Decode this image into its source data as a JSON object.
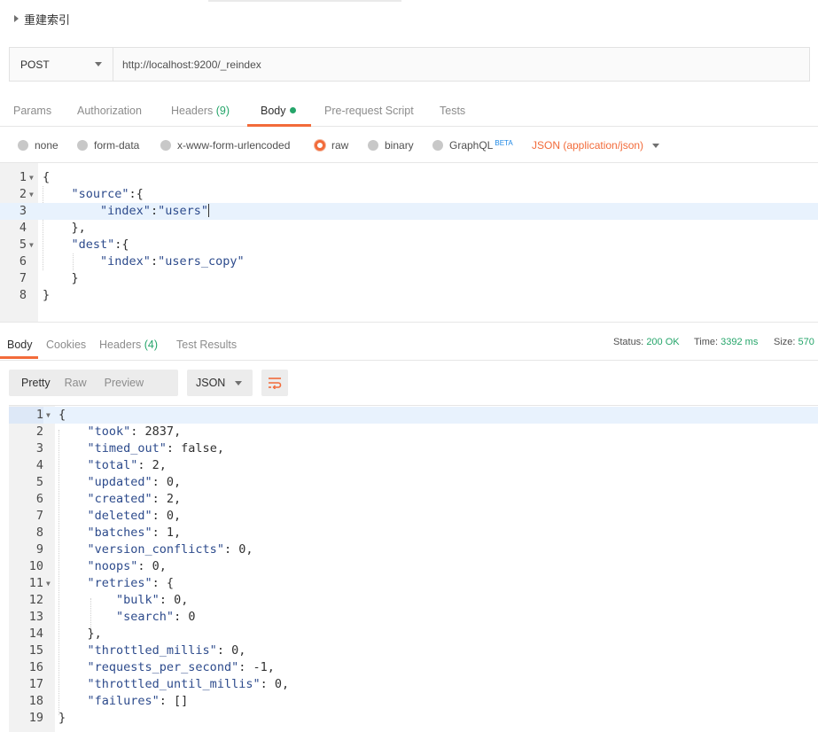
{
  "request": {
    "title": "重建索引",
    "method": "POST",
    "url": "http://localhost:9200/_reindex"
  },
  "request_tabs": [
    {
      "label": "Params"
    },
    {
      "label": "Authorization"
    },
    {
      "label": "Headers",
      "count": "(9)"
    },
    {
      "label": "Body"
    },
    {
      "label": "Pre-request Script"
    },
    {
      "label": "Tests"
    }
  ],
  "body_types": {
    "none": "none",
    "form_data": "form-data",
    "urlencoded": "x-www-form-urlencoded",
    "raw": "raw",
    "binary": "binary",
    "graphql": "GraphQL",
    "graphql_badge": "BETA",
    "content_type": "JSON (application/json)",
    "selected": "raw"
  },
  "request_body": [
    {
      "n": "1",
      "fold": true,
      "text": "{"
    },
    {
      "n": "2",
      "fold": true,
      "text": "    \"source\":{"
    },
    {
      "n": "3",
      "fold": false,
      "text": "        \"index\":\"users\""
    },
    {
      "n": "4",
      "fold": false,
      "text": "    },"
    },
    {
      "n": "5",
      "fold": true,
      "text": "    \"dest\":{"
    },
    {
      "n": "6",
      "fold": false,
      "text": "        \"index\":\"users_copy\""
    },
    {
      "n": "7",
      "fold": false,
      "text": "    }"
    },
    {
      "n": "8",
      "fold": false,
      "text": "}"
    }
  ],
  "response_tabs": [
    {
      "label": "Body"
    },
    {
      "label": "Cookies"
    },
    {
      "label": "Headers",
      "count": "(4)"
    },
    {
      "label": "Test Results"
    }
  ],
  "response_status": {
    "status_label": "Status:",
    "status_value": "200 OK",
    "time_label": "Time:",
    "time_value": "3392 ms",
    "size_label": "Size:",
    "size_value": "570"
  },
  "response_view": {
    "pretty": "Pretty",
    "raw": "Raw",
    "preview": "Preview",
    "format": "JSON",
    "wrap_icon": "wrap-lines-icon"
  },
  "response_body": [
    {
      "n": "1",
      "fold": true,
      "text": "{"
    },
    {
      "n": "2",
      "fold": false,
      "text": "    \"took\": 2837,"
    },
    {
      "n": "3",
      "fold": false,
      "text": "    \"timed_out\": false,"
    },
    {
      "n": "4",
      "fold": false,
      "text": "    \"total\": 2,"
    },
    {
      "n": "5",
      "fold": false,
      "text": "    \"updated\": 0,"
    },
    {
      "n": "6",
      "fold": false,
      "text": "    \"created\": 2,"
    },
    {
      "n": "7",
      "fold": false,
      "text": "    \"deleted\": 0,"
    },
    {
      "n": "8",
      "fold": false,
      "text": "    \"batches\": 1,"
    },
    {
      "n": "9",
      "fold": false,
      "text": "    \"version_conflicts\": 0,"
    },
    {
      "n": "10",
      "fold": false,
      "text": "    \"noops\": 0,"
    },
    {
      "n": "11",
      "fold": true,
      "text": "    \"retries\": {"
    },
    {
      "n": "12",
      "fold": false,
      "text": "        \"bulk\": 0,"
    },
    {
      "n": "13",
      "fold": false,
      "text": "        \"search\": 0"
    },
    {
      "n": "14",
      "fold": false,
      "text": "    },"
    },
    {
      "n": "15",
      "fold": false,
      "text": "    \"throttled_millis\": 0,"
    },
    {
      "n": "16",
      "fold": false,
      "text": "    \"requests_per_second\": -1,"
    },
    {
      "n": "17",
      "fold": false,
      "text": "    \"throttled_until_millis\": 0,"
    },
    {
      "n": "18",
      "fold": false,
      "text": "    \"failures\": []"
    },
    {
      "n": "19",
      "fold": false,
      "text": "}"
    }
  ],
  "colors": {
    "accent": "#f26b3a",
    "success": "#25a56a",
    "json_key": "#2d4b8c",
    "badge": "#1e88e5"
  }
}
